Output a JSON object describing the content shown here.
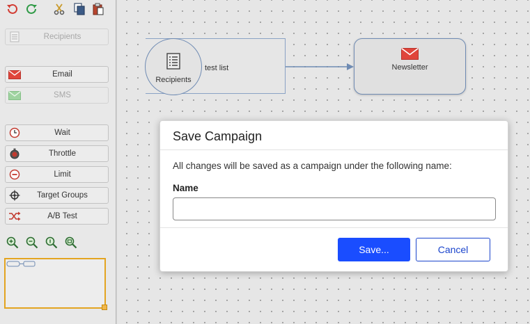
{
  "toolbar": {
    "icons": [
      "undo-icon",
      "redo-icon",
      "cut-icon",
      "copy-icon",
      "paste-icon"
    ]
  },
  "sidebar": {
    "items": [
      {
        "label": "Recipients",
        "icon": "list-icon",
        "disabled": true
      },
      {
        "label": "Email",
        "icon": "envelope-icon",
        "disabled": false
      },
      {
        "label": "SMS",
        "icon": "sms-icon",
        "disabled": true
      },
      {
        "label": "Wait",
        "icon": "clock-icon",
        "disabled": false
      },
      {
        "label": "Throttle",
        "icon": "stopwatch-icon",
        "disabled": false
      },
      {
        "label": "Limit",
        "icon": "limit-icon",
        "disabled": false
      },
      {
        "label": "Target Groups",
        "icon": "target-icon",
        "disabled": false
      },
      {
        "label": "A/B Test",
        "icon": "shuffle-icon",
        "disabled": false
      }
    ],
    "zoom_icons": [
      "zoom-in-icon",
      "zoom-out-icon",
      "zoom-actual-icon",
      "zoom-fit-icon"
    ]
  },
  "canvas": {
    "recipients_node": {
      "label": "Recipients",
      "list_name": "test list"
    },
    "newsletter_node": {
      "label": "Newsletter"
    }
  },
  "dialog": {
    "title": "Save Campaign",
    "message": "All changes will be saved as a campaign under the following name:",
    "name_label": "Name",
    "name_value": "",
    "save_label": "Save...",
    "cancel_label": "Cancel"
  },
  "colors": {
    "accent": "#1a4dff",
    "email_red": "#e0453b",
    "node_border": "#6f8bb3",
    "minimap_border": "#e3a420"
  }
}
